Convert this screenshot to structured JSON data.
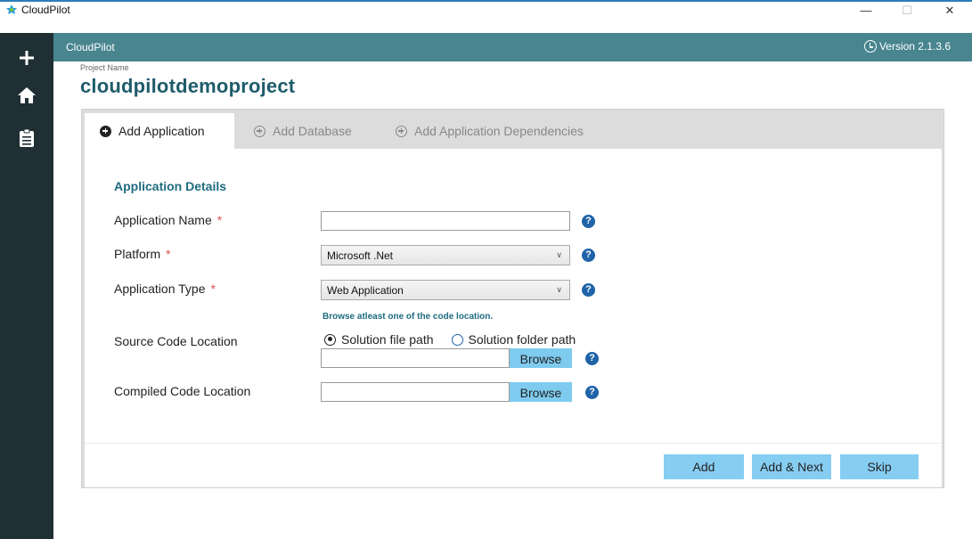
{
  "window": {
    "title": "CloudPilot",
    "minimize": "—",
    "maximize": "☐",
    "close": "✕"
  },
  "header": {
    "brand": "CloudPilot",
    "version": "Version 2.1.3.6"
  },
  "rail": {
    "icons": [
      "plus-icon",
      "home-icon",
      "report-icon"
    ]
  },
  "project": {
    "label": "Project Name",
    "name": "cloudpilotdemoproject"
  },
  "tabs": [
    {
      "label": "Add Application",
      "active": true
    },
    {
      "label": "Add Database",
      "active": false
    },
    {
      "label": "Add Application Dependencies",
      "active": false
    }
  ],
  "form": {
    "section_title": "Application Details",
    "required_mark": "*",
    "application_name": {
      "label": "Application Name",
      "value": ""
    },
    "platform": {
      "label": "Platform",
      "value": "Microsoft .Net"
    },
    "application_type": {
      "label": "Application Type",
      "value": "Web Application"
    },
    "hint": "Browse atleast one of the code location.",
    "source_code": {
      "label": "Source Code Location",
      "option_file": "Solution file path",
      "option_folder": "Solution folder path",
      "selected": "file",
      "value": "",
      "browse": "Browse"
    },
    "compiled_code": {
      "label": "Compiled Code Location",
      "value": "",
      "browse": "Browse"
    },
    "help_glyph": "?"
  },
  "footer": {
    "add": "Add",
    "add_next": "Add & Next",
    "skip": "Skip"
  },
  "colors": {
    "rail": "#1f2f33",
    "header": "#48858f",
    "accent_text": "#1f6c80",
    "button": "#86cdf2",
    "help": "#1f63a8"
  }
}
